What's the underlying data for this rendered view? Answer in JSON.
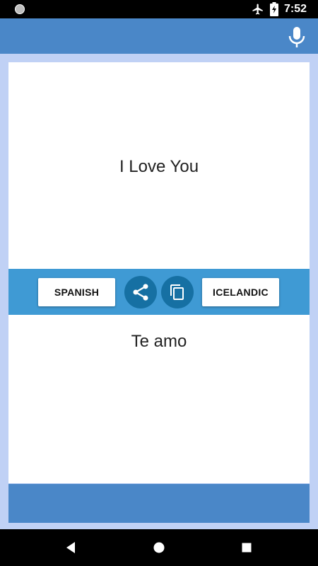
{
  "status_bar": {
    "time": "7:52",
    "left_icon": "circle-notification-icon",
    "icons": [
      "airplane-mode-icon",
      "battery-charging-icon"
    ]
  },
  "app_bar": {
    "action_icon": "microphone-icon"
  },
  "translation": {
    "source_text": "I Love You",
    "target_text": "Te amo"
  },
  "controls": {
    "source_language": "SPANISH",
    "target_language": "ICELANDIC",
    "share_icon": "share-icon",
    "copy_icon": "copy-icon"
  },
  "navigation": {
    "back_icon": "back-triangle-icon",
    "home_icon": "home-circle-icon",
    "recents_icon": "recents-square-icon"
  },
  "colors": {
    "app_bar": "#4a87c8",
    "control_strip": "#3f9ad4",
    "round_button": "#1670a3",
    "background": "#c0d1f5"
  }
}
